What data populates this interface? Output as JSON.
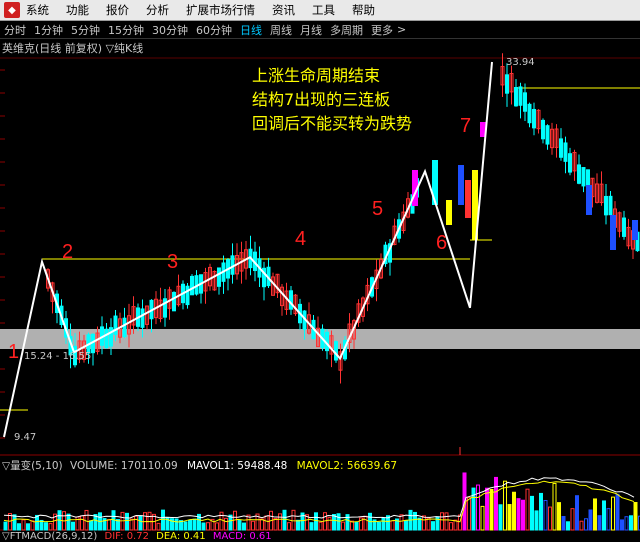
{
  "menu": {
    "items": [
      "系统",
      "功能",
      "报价",
      "分析",
      "扩展市场行情",
      "资讯",
      "工具",
      "帮助"
    ]
  },
  "periods": {
    "items": [
      "分时",
      "1分钟",
      "5分钟",
      "15分钟",
      "30分钟",
      "60分钟",
      "日线",
      "周线",
      "月线",
      "多周期",
      "更多"
    ],
    "active": "日线"
  },
  "header": {
    "title": "英维克(日线 前复权) ▽纯K线"
  },
  "annotation": {
    "line1": "上涨生命周期结束",
    "line2": "结构7出现的三连板",
    "line3": "回调后不能买转为跌势"
  },
  "price": {
    "high_label": "33.94",
    "low_label": "9.47",
    "gap_label": "15.24 - 16.55"
  },
  "structure_labels": [
    "1",
    "2",
    "3",
    "4",
    "5",
    "6",
    "7"
  ],
  "volume": {
    "prefix": "▽量变(5,10)",
    "volume_label": "VOLUME: 170110.09",
    "mavol1_label": "MAVOL1: 59488.48",
    "mavol2_label": "MAVOL2: 56639.67"
  },
  "macd": {
    "prefix": "▽FTMACD(26,9,12)",
    "dif_label": "DIF: 0.72",
    "dea_label": "DEA: 0.41",
    "macd_label": "MACD: 0.61"
  },
  "colors": {
    "up": "#ff3232",
    "down": "#00ffff",
    "annotation": "#ffff00",
    "wave": "#ffffff",
    "gap": "#b0b0b0",
    "active_period": "#00c8ff"
  },
  "chart_data": {
    "type": "candlestick",
    "price_range": [
      9.47,
      33.94
    ],
    "wave_points": [
      {
        "label": "start",
        "price": 9.47
      },
      {
        "label": "1",
        "price": 20.9
      },
      {
        "label": "2",
        "price": 15.0
      },
      {
        "label": "3",
        "price": 21.2
      },
      {
        "label": "4",
        "price": 14.6
      },
      {
        "label": "5",
        "price": 26.8
      },
      {
        "label": "6",
        "price": 17.9
      },
      {
        "label": "7",
        "price": 33.94
      }
    ]
  }
}
